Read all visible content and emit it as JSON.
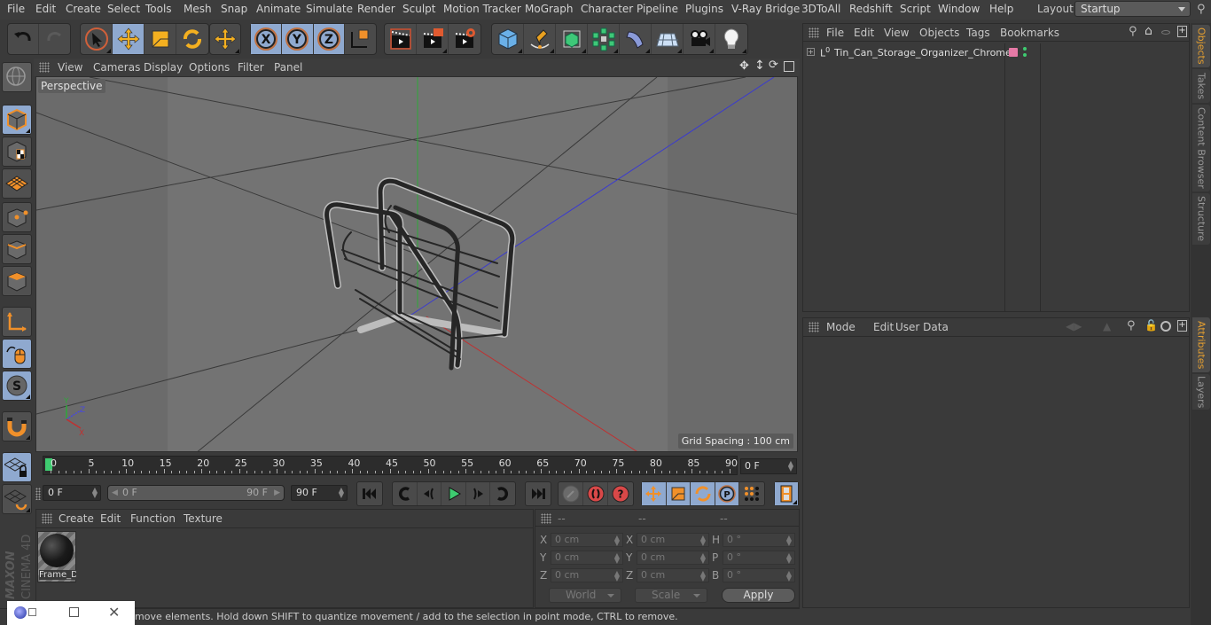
{
  "menubar": {
    "items": [
      "File",
      "Edit",
      "Create",
      "Select",
      "Tools",
      "Mesh",
      "Snap",
      "Animate",
      "Simulate",
      "Render",
      "Sculpt",
      "Motion Tracker",
      "MoGraph",
      "Character",
      "Pipeline",
      "Plugins",
      "V-Ray Bridge",
      "3DToAll",
      "Redshift",
      "Script",
      "Window",
      "Help"
    ],
    "layout_label": "Layout:",
    "layout_value": "Startup"
  },
  "viewport": {
    "menu": [
      "View",
      "Cameras",
      "Display",
      "Options",
      "Filter",
      "Panel"
    ],
    "camera_label": "Perspective",
    "grid_spacing": "Grid Spacing : 100 cm",
    "axis_labels": {
      "x": "X",
      "y": "Y",
      "z": "Z"
    }
  },
  "timeline": {
    "ticks": [
      "0",
      "5",
      "10",
      "15",
      "20",
      "25",
      "30",
      "35",
      "40",
      "45",
      "50",
      "55",
      "60",
      "65",
      "70",
      "75",
      "80",
      "85",
      "90"
    ],
    "current_frame": "0 F",
    "start_field": "0 F",
    "range_start": "0 F",
    "range_end": "90 F",
    "end_field": "90 F",
    "playhead_frame": 0
  },
  "material_panel": {
    "menu": [
      "Create",
      "Edit",
      "Function",
      "Texture"
    ],
    "materials": [
      {
        "name": "Frame_D"
      }
    ]
  },
  "coord_panel": {
    "headers": [
      "--",
      "--",
      "--"
    ],
    "rows": [
      {
        "l1": "X",
        "v1": "0 cm",
        "l2": "X",
        "v2": "0 cm",
        "l3": "H",
        "v3": "0 °"
      },
      {
        "l1": "Y",
        "v1": "0 cm",
        "l2": "Y",
        "v2": "0 cm",
        "l3": "P",
        "v3": "0 °"
      },
      {
        "l1": "Z",
        "v1": "0 cm",
        "l2": "Z",
        "v2": "0 cm",
        "l3": "B",
        "v3": "0 °"
      }
    ],
    "mode_dropdown": "World",
    "type_dropdown": "Scale",
    "apply_label": "Apply"
  },
  "status": {
    "text": "move elements. Hold down SHIFT to quantize movement / add to the selection in point mode, CTRL to remove."
  },
  "objects_panel": {
    "menu": [
      "File",
      "Edit",
      "View",
      "Objects",
      "Tags",
      "Bookmarks"
    ],
    "objects": [
      {
        "name": "Tin_Can_Storage_Organizer_Chrome",
        "tag_color": "#e67aa6"
      }
    ]
  },
  "attributes_panel": {
    "menu": [
      "Mode",
      "Edit",
      "User Data"
    ]
  },
  "side_tabs": {
    "top": [
      "Objects",
      "Takes",
      "Content Browser",
      "Structure"
    ],
    "bottom": [
      "Attributes",
      "Layers"
    ]
  },
  "logo": {
    "brand": "MAXON",
    "product": "CINEMA 4D"
  },
  "colors": {
    "accent": "#8fa9cf",
    "orange": "#f0a030",
    "playhead": "#3ecb70",
    "tab_active": "#e7a030"
  }
}
